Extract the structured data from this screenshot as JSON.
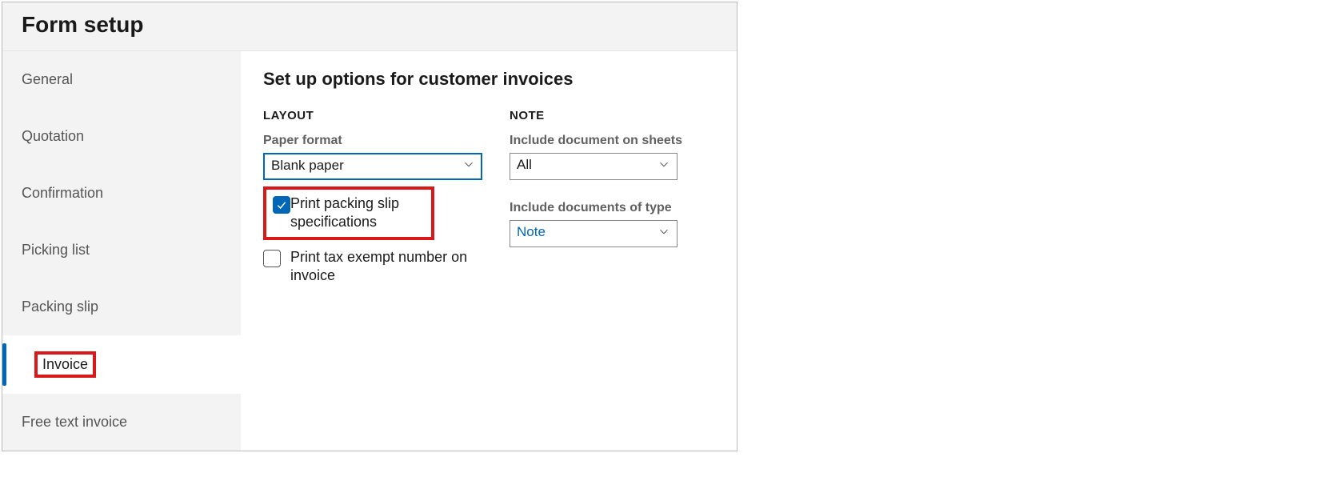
{
  "pageTitle": "Form setup",
  "sidebar": {
    "items": [
      {
        "label": "General",
        "active": false,
        "highlight": false
      },
      {
        "label": "Quotation",
        "active": false,
        "highlight": false
      },
      {
        "label": "Confirmation",
        "active": false,
        "highlight": false
      },
      {
        "label": "Picking list",
        "active": false,
        "highlight": false
      },
      {
        "label": "Packing slip",
        "active": false,
        "highlight": false
      },
      {
        "label": "Invoice",
        "active": true,
        "highlight": true
      },
      {
        "label": "Free text invoice",
        "active": false,
        "highlight": false
      }
    ]
  },
  "main": {
    "heading": "Set up options for customer invoices",
    "layout": {
      "sectionLabel": "LAYOUT",
      "paperFormat": {
        "label": "Paper format",
        "value": "Blank paper"
      },
      "packingSlipSpec": {
        "label": "Print packing slip specifications",
        "checked": true,
        "highlight": true
      },
      "taxExempt": {
        "label": "Print tax exempt number on invoice",
        "checked": false
      }
    },
    "note": {
      "sectionLabel": "NOTE",
      "includeSheets": {
        "label": "Include document on sheets",
        "value": "All"
      },
      "includeType": {
        "label": "Include documents of type",
        "value": "Note"
      }
    }
  }
}
